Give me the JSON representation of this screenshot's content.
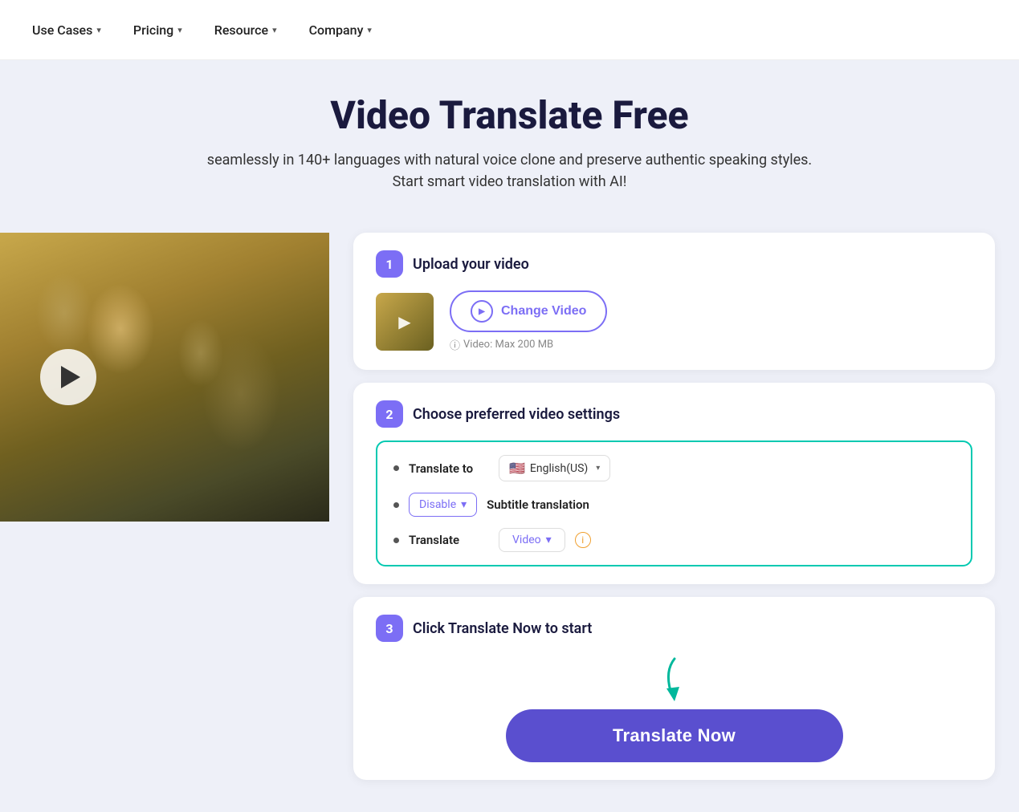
{
  "nav": {
    "items": [
      {
        "label": "Use Cases",
        "hasDropdown": true
      },
      {
        "label": "Pricing",
        "hasDropdown": true
      },
      {
        "label": "Resource",
        "hasDropdown": true
      },
      {
        "label": "Company",
        "hasDropdown": true
      }
    ]
  },
  "hero": {
    "title": "Video Translate Free",
    "subtitle": "seamlessly in 140+ languages with natural voice clone and preserve authentic speaking styles. Start smart video translation with AI!"
  },
  "steps": {
    "step1": {
      "badge": "1",
      "title": "Upload your video",
      "changeVideoLabel": "Change Video",
      "videoInfo": "Video: Max 200 MB"
    },
    "step2": {
      "badge": "2",
      "title": "Choose preferred video settings",
      "translateToLabel": "Translate to",
      "language": "English(US)",
      "subtitleDisableLabel": "Disable",
      "subtitleLabel": "Subtitle translation",
      "translateLabel": "Translate",
      "translateOptionLabel": "Video"
    },
    "step3": {
      "badge": "3",
      "title": "Click Translate Now to start",
      "buttonLabel": "Translate Now"
    }
  }
}
